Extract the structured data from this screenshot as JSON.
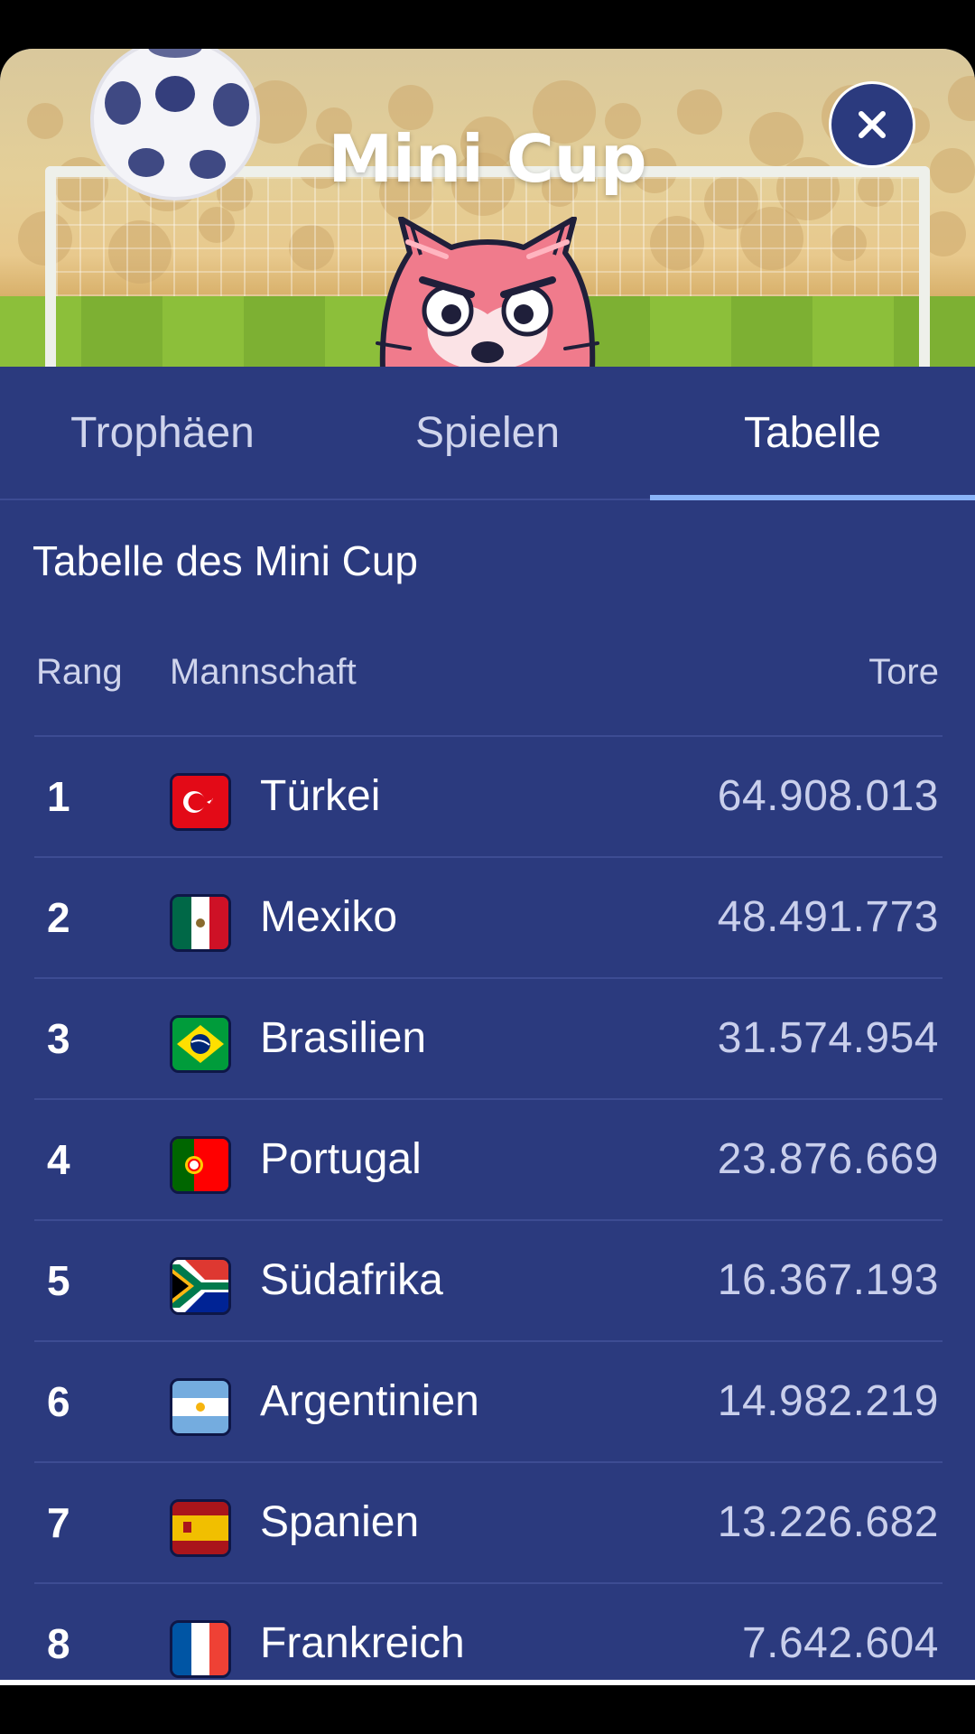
{
  "header": {
    "title": "Mini Cup",
    "close_icon": "close-icon",
    "ball_icon": "soccer-ball-icon",
    "mascot_icon": "cat-goalkeeper-icon"
  },
  "tabs": [
    {
      "label": "Trophäen",
      "active": false
    },
    {
      "label": "Spielen",
      "active": false
    },
    {
      "label": "Tabelle",
      "active": true
    }
  ],
  "table": {
    "title": "Tabelle des Mini Cup",
    "columns": {
      "rank": "Rang",
      "team": "Mannschaft",
      "goals": "Tore"
    },
    "rows": [
      {
        "rank": "1",
        "team": "Türkei",
        "goals": "64.908.013",
        "flag": "turkey-flag-icon"
      },
      {
        "rank": "2",
        "team": "Mexiko",
        "goals": "48.491.773",
        "flag": "mexico-flag-icon"
      },
      {
        "rank": "3",
        "team": "Brasilien",
        "goals": "31.574.954",
        "flag": "brazil-flag-icon"
      },
      {
        "rank": "4",
        "team": "Portugal",
        "goals": "23.876.669",
        "flag": "portugal-flag-icon"
      },
      {
        "rank": "5",
        "team": "Südafrika",
        "goals": "16.367.193",
        "flag": "south-africa-flag-icon"
      },
      {
        "rank": "6",
        "team": "Argentinien",
        "goals": "14.982.219",
        "flag": "argentina-flag-icon"
      },
      {
        "rank": "7",
        "team": "Spanien",
        "goals": "13.226.682",
        "flag": "spain-flag-icon"
      },
      {
        "rank": "8",
        "team": "Frankreich",
        "goals": "7.642.604",
        "flag": "france-flag-icon"
      }
    ]
  },
  "colors": {
    "panel": "#2b3a7e",
    "tab_indicator": "#8ab4f8",
    "text": "#ffffff",
    "muted_text": "#c9cfec"
  }
}
